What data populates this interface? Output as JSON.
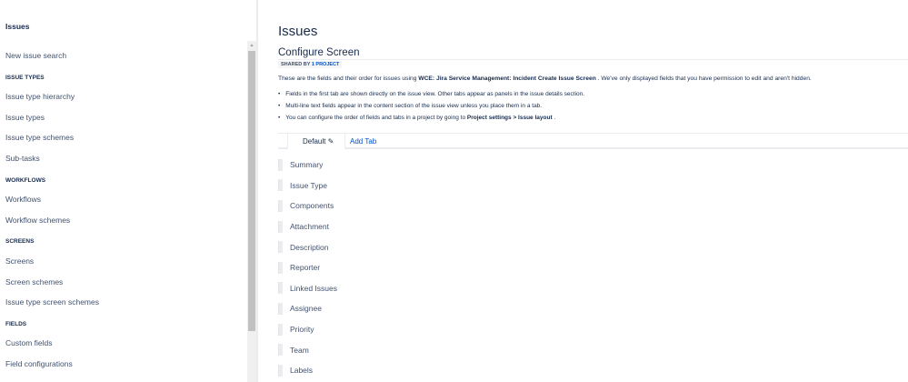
{
  "sidebar": {
    "title": "Issues",
    "items": [
      {
        "type": "link",
        "label": "New issue search"
      },
      {
        "type": "head",
        "label": "ISSUE TYPES"
      },
      {
        "type": "link",
        "label": "Issue type hierarchy"
      },
      {
        "type": "link",
        "label": "Issue types"
      },
      {
        "type": "link",
        "label": "Issue type schemes"
      },
      {
        "type": "link",
        "label": "Sub-tasks"
      },
      {
        "type": "head",
        "label": "WORKFLOWS"
      },
      {
        "type": "link",
        "label": "Workflows"
      },
      {
        "type": "link",
        "label": "Workflow schemes"
      },
      {
        "type": "head",
        "label": "SCREENS"
      },
      {
        "type": "link",
        "label": "Screens"
      },
      {
        "type": "link",
        "label": "Screen schemes"
      },
      {
        "type": "link",
        "label": "Issue type screen schemes"
      },
      {
        "type": "head",
        "label": "FIELDS"
      },
      {
        "type": "link",
        "label": "Custom fields"
      },
      {
        "type": "link",
        "label": "Field configurations"
      }
    ]
  },
  "main": {
    "title": "Issues",
    "subtitle": "Configure Screen",
    "badge_prefix": "SHARED BY ",
    "badge_link": "1 PROJECT",
    "desc_pre": "These are the fields and their order for issues using ",
    "desc_bold": "WCE: Jira Service Management: Incident Create Issue Screen",
    "desc_post": " . We've only displayed fields that you have permission to edit and aren't hidden.",
    "bullets": {
      "b1": "Fields in the first tab are shown directly on the issue view. Other tabs appear as panels in the issue details section.",
      "b2": "Multi-line text fields appear in the content section of the issue view unless you place them in a tab.",
      "b3_pre": "You can configure the order of fields and tabs in a project by going to ",
      "b3_bold": "Project settings > Issue layout",
      "b3_post": " ."
    },
    "tabs": {
      "active": "Default",
      "add": "Add Tab"
    },
    "fields": [
      "Summary",
      "Issue Type",
      "Components",
      "Attachment",
      "Description",
      "Reporter",
      "Linked Issues",
      "Assignee",
      "Priority",
      "Team",
      "Labels"
    ]
  }
}
